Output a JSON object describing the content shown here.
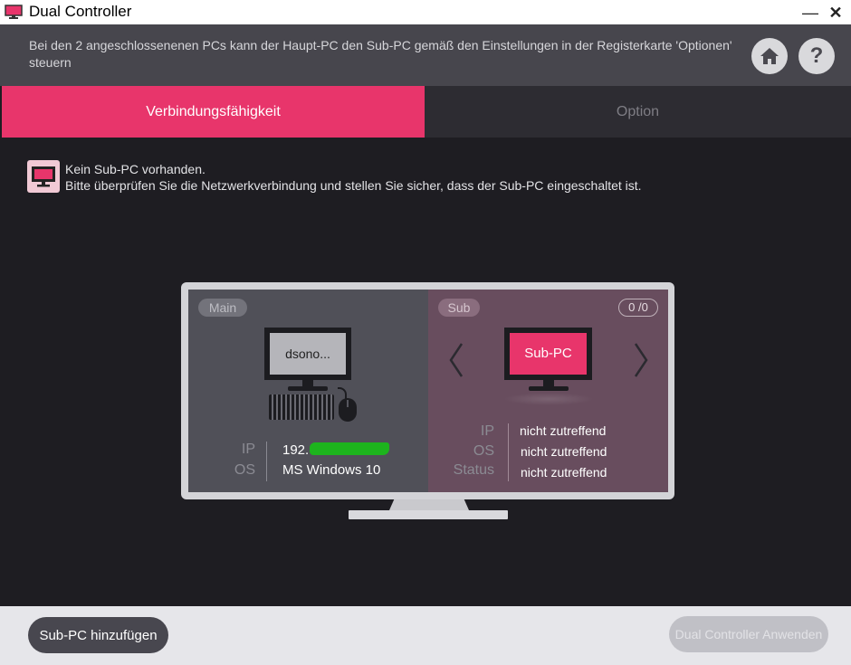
{
  "window": {
    "title": "Dual Controller"
  },
  "header": {
    "description": "Bei den 2 angeschlossenenen PCs kann der Haupt-PC den Sub-PC gemäß den Einstellungen in der Registerkarte 'Optionen' steuern"
  },
  "tabs": [
    {
      "label": "Verbindungsfähigkeit",
      "active": true
    },
    {
      "label": "Option",
      "active": false
    }
  ],
  "notice": {
    "line1": "Kein Sub-PC vorhanden.",
    "line2": "Bitte überprüfen Sie die Netzwerkverbindung und stellen Sie sicher, dass der Sub-PC eingeschaltet ist."
  },
  "main_pc": {
    "tag": "Main",
    "screen_name": "dsono...",
    "labels": {
      "ip": "IP",
      "os": "OS"
    },
    "ip": "192.",
    "os": "MS Windows 10"
  },
  "sub_pc": {
    "tag": "Sub",
    "count": "0 /0",
    "screen_name": "Sub-PC",
    "labels": {
      "ip": "IP",
      "os": "OS",
      "status": "Status"
    },
    "ip": "nicht zutreffend",
    "os": "nicht zutreffend",
    "status": "nicht zutreffend"
  },
  "footer": {
    "add_button": "Sub-PC hinzufügen",
    "apply_button": "Dual Controller Anwenden"
  },
  "colors": {
    "accent": "#e8356b",
    "background": "#1e1d22",
    "header": "#47464d"
  },
  "icons": {
    "app": "monitor-icon",
    "home": "home-icon",
    "help": "help-icon",
    "notice": "monitor-icon"
  }
}
